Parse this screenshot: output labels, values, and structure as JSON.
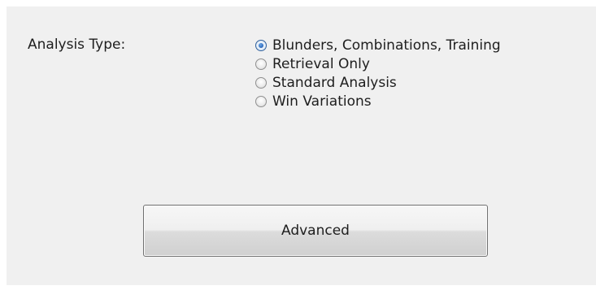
{
  "analysis": {
    "label": "Analysis Type:",
    "options": [
      {
        "label": "Blunders, Combinations, Training",
        "selected": true
      },
      {
        "label": "Retrieval Only",
        "selected": false
      },
      {
        "label": "Standard Analysis",
        "selected": false
      },
      {
        "label": "Win Variations",
        "selected": false
      }
    ]
  },
  "buttons": {
    "advanced_label": "Advanced"
  }
}
